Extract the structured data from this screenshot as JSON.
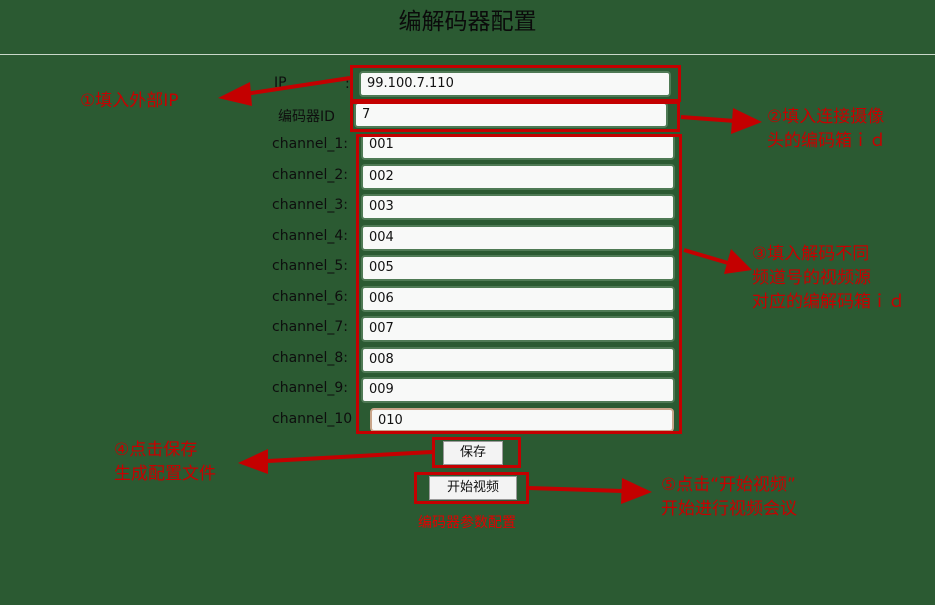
{
  "title": "编解码器配置",
  "form": {
    "ip_label": "IP",
    "ip_colon": ":",
    "ip_value": "99.100.7.110",
    "codec_id_label": "编码器ID",
    "codec_id_value": "7",
    "channels": [
      {
        "label": "channel_1:",
        "value": "001"
      },
      {
        "label": "channel_2:",
        "value": "002"
      },
      {
        "label": "channel_3:",
        "value": "003"
      },
      {
        "label": "channel_4:",
        "value": "004"
      },
      {
        "label": "channel_5:",
        "value": "005"
      },
      {
        "label": "channel_6:",
        "value": "006"
      },
      {
        "label": "channel_7:",
        "value": "007"
      },
      {
        "label": "channel_8:",
        "value": "008"
      },
      {
        "label": "channel_9:",
        "value": "009"
      },
      {
        "label": "channel_10",
        "value": "010"
      }
    ],
    "save_label": "保存",
    "start_video_label": "开始视频",
    "caption": "编码器参数配置"
  },
  "annotations": {
    "note1": "①填入外部IP",
    "note2_line1": "②填入连接摄像",
    "note2_line2": "头的编码箱ｉｄ",
    "note3_line1": "③填入解码不同",
    "note3_line2": "频道号的视频源",
    "note3_line3": "对应的编解码箱ｉｄ",
    "note4_line1": "④点击保存",
    "note4_line2": "生成配置文件",
    "note5_line1": "⑤点击“开始视频”",
    "note5_line2": "开始进行视频会议"
  },
  "colors": {
    "background": "#2b5a32",
    "annotation_red": "#c40000"
  }
}
